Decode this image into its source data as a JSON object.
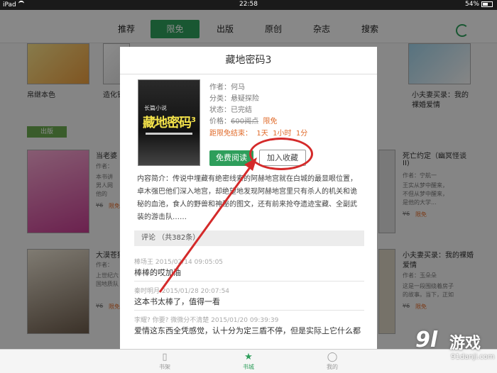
{
  "status_bar": {
    "carrier": "iPad",
    "time": "22:58",
    "battery": "54%"
  },
  "tabs": [
    {
      "label": "推荐",
      "active": false
    },
    {
      "label": "限免",
      "active": true
    },
    {
      "label": "出版",
      "active": false
    },
    {
      "label": "原创",
      "active": false
    },
    {
      "label": "杂志",
      "active": false
    },
    {
      "label": "搜索",
      "active": false
    }
  ],
  "accent_color": "#2e9e5b",
  "background": {
    "row1_titles": [
      "帛继本色",
      "造化钟",
      "小夫妻买录：我的",
      "裸婚爱情"
    ],
    "section_tag": "出版",
    "row2_left_title": "当老婆",
    "row2_left_author": "作者：",
    "row2_left_desc1": "本书讲",
    "row2_left_desc2": "男人网",
    "row2_left_desc3": "他的",
    "row2_left_price": "¥6",
    "row2_left_badge": "限免",
    "row2_right_title": "死亡约定（幽冥怪谈",
    "row2_right_title2": "II)",
    "row2_right_author": "作者：宁航一",
    "row2_right_desc1": "王实从梦中醒来，",
    "row2_right_desc2": "不但从梦中醒来，",
    "row2_right_desc3": "是他的大学...",
    "row2_right_price": "¥6",
    "row2_right_badge": "限免",
    "row3_left_title": "大漠苍狼",
    "row3_left_author": "作者：",
    "row3_left_desc1": "上世纪六",
    "row3_left_desc2": "国地质队",
    "row3_left_price": "¥6",
    "row3_left_badge": "限免",
    "row3_right_title": "小夫妻买录：我的裸婚",
    "row3_right_title2": "爱情",
    "row3_right_author": "作者：玉朵朵",
    "row3_right_desc1": "这是一段围绕着房子",
    "row3_right_desc2": "的故事。当下，正如",
    "row3_right_price": "¥6",
    "row3_right_badge": "限免"
  },
  "dialog": {
    "title": "藏地密码3",
    "cover_small": "长篇小说",
    "cover_title": "藏地密码",
    "cover_num": "3",
    "author": "作者：何马",
    "category": "分类：悬疑探险",
    "status": "状态：已完结",
    "price_label": "价格：",
    "price_orig": "600阅点",
    "price_badge": "限免",
    "countdown_label": "距限免结束：",
    "countdown_day": "1天",
    "countdown_hour": "1小时",
    "countdown_min": "1分",
    "btn_free": "免费阅读",
    "btn_fav": "加入收藏",
    "intro": "内容简介：传说中埋藏有绝密线索的阿赫地宫就在白城的最显眼位置，卓木强巴他们深入地宫，却绝望地发现阿赫地宫里只有杀人的机关和诡秘的血池，食人的野兽和神秘的图文，还有前来抢夺遗迹宝藏、全副武装的游击队……",
    "comments_header": "评论 （共382条）",
    "comments": [
      {
        "meta": "棒场王 2015/02/14 09:05:05",
        "text": "棒棒的哎加油"
      },
      {
        "meta": "秦时明月 2015/01/28 20:07:54",
        "text": "这本书太棒了，值得一看"
      },
      {
        "meta": "李耀? 你要? 微微分不清楚 2015/01/20 09:39:39",
        "text": "爱情这东西全凭感觉，认十分为定三盾不停，但是实际上它什么都"
      }
    ]
  },
  "bottom_nav": [
    {
      "label": "书架",
      "icon": "bookshelf-icon",
      "active": false
    },
    {
      "label": "书城",
      "icon": "star-icon",
      "active": true
    },
    {
      "label": "我的",
      "icon": "user-icon",
      "active": false
    }
  ],
  "watermark": {
    "logo": "9l",
    "text": "游戏",
    "url": "91danji.com"
  }
}
